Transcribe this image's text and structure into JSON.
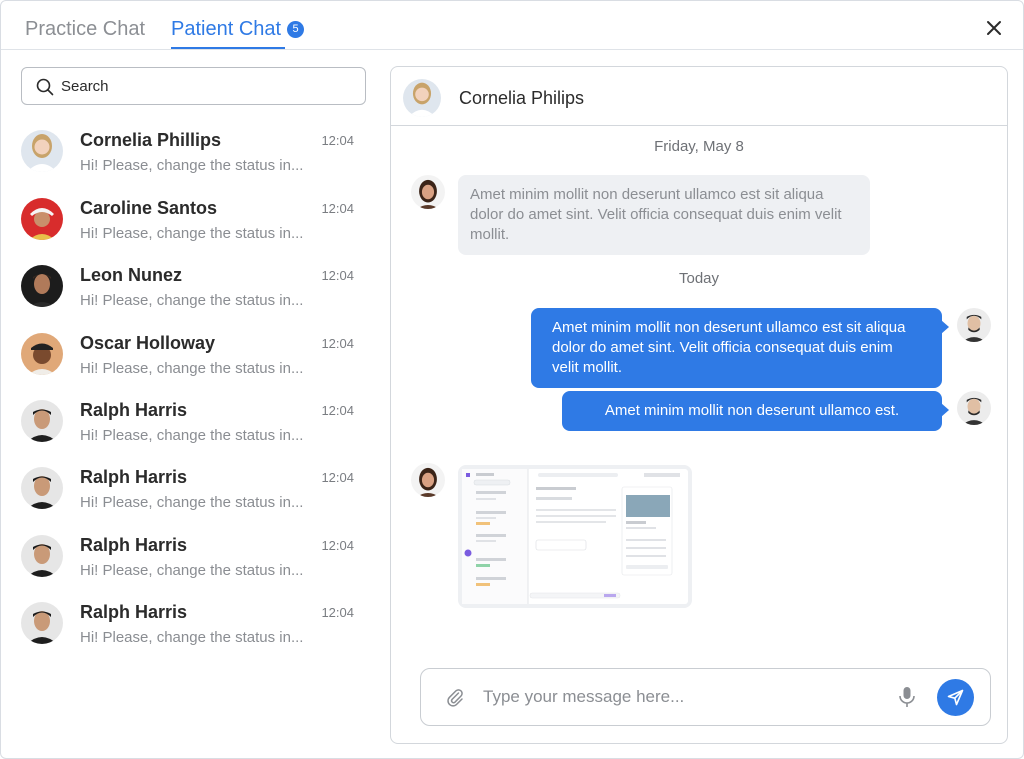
{
  "tabs": {
    "practice": "Practice Chat",
    "patient": "Patient Chat",
    "patient_badge": "5"
  },
  "search": {
    "placeholder": "Search"
  },
  "contacts": [
    {
      "name": "Cornelia Phillips",
      "time": "12:04",
      "preview": "Hi! Please, change the status in..."
    },
    {
      "name": "Caroline Santos",
      "time": "12:04",
      "preview": "Hi! Please, change the status in..."
    },
    {
      "name": "Leon Nunez",
      "time": "12:04",
      "preview": "Hi! Please, change the status in..."
    },
    {
      "name": "Oscar Holloway",
      "time": "12:04",
      "preview": "Hi! Please, change the status in..."
    },
    {
      "name": "Ralph Harris",
      "time": "12:04",
      "preview": "Hi! Please, change the status in..."
    },
    {
      "name": "Ralph Harris",
      "time": "12:04",
      "preview": "Hi! Please, change the status in..."
    },
    {
      "name": "Ralph Harris",
      "time": "12:04",
      "preview": "Hi! Please, change the status in..."
    },
    {
      "name": "Ralph Harris",
      "time": "12:04",
      "preview": "Hi! Please, change the status in..."
    }
  ],
  "chat": {
    "title": "Cornelia Philips",
    "date_1": "Friday, May 8",
    "date_2": "Today",
    "messages": [
      {
        "direction": "in",
        "text": "Amet minim mollit non deserunt ullamco est sit aliqua dolor do amet sint. Velit officia consequat duis enim velit mollit."
      },
      {
        "direction": "out",
        "text": "Amet minim mollit non deserunt ullamco est sit aliqua dolor do amet sint. Velit officia consequat duis enim velit mollit."
      },
      {
        "direction": "out",
        "text": "Amet minim mollit non deserunt ullamco est."
      }
    ]
  },
  "composer": {
    "placeholder": "Type your message here..."
  },
  "colors": {
    "accent": "#2f7ae5",
    "bubble_in": "#eef0f3",
    "muted_text": "#8b8e93"
  },
  "icons": [
    "close-icon",
    "search-icon",
    "paperclip-icon",
    "microphone-icon",
    "send-icon"
  ]
}
